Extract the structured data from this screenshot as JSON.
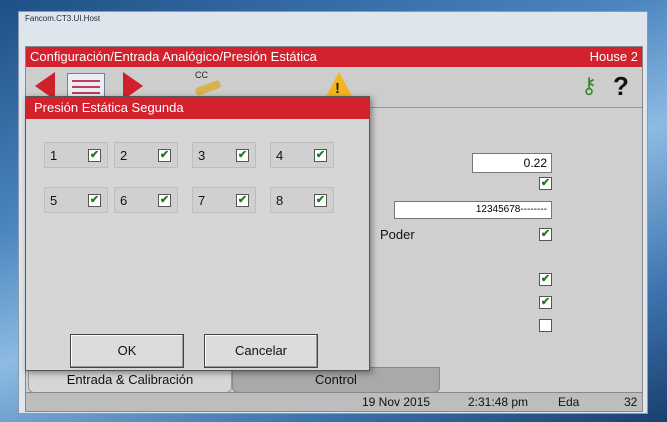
{
  "window": {
    "title": "Fancom.CT3.UI.Host"
  },
  "header": {
    "path": "Configuración/Entrada Analógico/Presión Estática",
    "house": "House 2"
  },
  "toolbar": {
    "icons": [
      "arrow-left-icon",
      "list-icon",
      "arrow-right-icon",
      "cc-key-icon",
      "warning-icon",
      "keys-icon",
      "help-icon"
    ],
    "cc_label": "CC",
    "warning_glyph": "!",
    "help_glyph": "?"
  },
  "main": {
    "value": "0.22",
    "serial": "12345678--------",
    "poder_label": "Poder",
    "checkboxes": {
      "cb1": true,
      "cb2": true,
      "cb3": true,
      "cb4": true,
      "cb5": false
    }
  },
  "tabs": [
    {
      "label": "Entrada & Calibración"
    },
    {
      "label": "Control"
    }
  ],
  "status": {
    "date": "19 Nov 2015",
    "time": "2:31:48 pm",
    "user": "Eda",
    "count": "32"
  },
  "dialog": {
    "title": "Presión Estática Segunda",
    "items": [
      {
        "num": "1",
        "checked": true
      },
      {
        "num": "2",
        "checked": true
      },
      {
        "num": "3",
        "checked": true
      },
      {
        "num": "4",
        "checked": true
      },
      {
        "num": "5",
        "checked": true
      },
      {
        "num": "6",
        "checked": true
      },
      {
        "num": "7",
        "checked": true
      },
      {
        "num": "8",
        "checked": true
      }
    ],
    "ok_label": "OK",
    "cancel_label": "Cancelar"
  },
  "colors": {
    "accent": "#d1222e",
    "check": "#1f7a1f"
  }
}
